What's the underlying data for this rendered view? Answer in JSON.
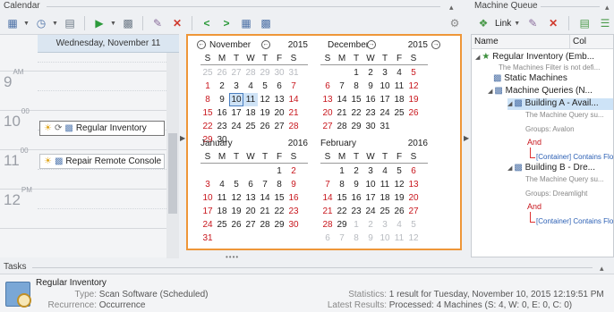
{
  "calendar": {
    "title": "Calendar",
    "day_header": "Wednesday, November 11",
    "hours": [
      {
        "hour": "9",
        "suffix": "AM"
      },
      {
        "hour": "10",
        "suffix": "00"
      },
      {
        "hour": "11",
        "suffix": "00"
      },
      {
        "hour": "12",
        "suffix": "PM"
      }
    ],
    "appointments": [
      {
        "label": "Regular Inventory"
      },
      {
        "label": "Repair Remote Console"
      }
    ]
  },
  "months": [
    {
      "name": "November",
      "year": "2015",
      "dow": [
        "S",
        "M",
        "T",
        "W",
        "T",
        "F",
        "S"
      ],
      "days": [
        [
          "25",
          "o"
        ],
        [
          "26",
          "o"
        ],
        [
          "27",
          "o"
        ],
        [
          "28",
          "o"
        ],
        [
          "29",
          "o"
        ],
        [
          "30",
          "o"
        ],
        [
          "31",
          "o"
        ],
        [
          "1",
          "e"
        ],
        [
          "2",
          "w"
        ],
        [
          "3",
          "w"
        ],
        [
          "4",
          "w"
        ],
        [
          "5",
          "w"
        ],
        [
          "6",
          "w"
        ],
        [
          "7",
          "e"
        ],
        [
          "8",
          "e"
        ],
        [
          "9",
          "w"
        ],
        [
          "10",
          "t"
        ],
        [
          "11",
          "s"
        ],
        [
          "12",
          "w"
        ],
        [
          "13",
          "w"
        ],
        [
          "14",
          "e"
        ],
        [
          "15",
          "e"
        ],
        [
          "16",
          "w"
        ],
        [
          "17",
          "w"
        ],
        [
          "18",
          "w"
        ],
        [
          "19",
          "w"
        ],
        [
          "20",
          "w"
        ],
        [
          "21",
          "e"
        ],
        [
          "22",
          "e"
        ],
        [
          "23",
          "w"
        ],
        [
          "24",
          "w"
        ],
        [
          "25",
          "w"
        ],
        [
          "26",
          "w"
        ],
        [
          "27",
          "w"
        ],
        [
          "28",
          "e"
        ],
        [
          "29",
          "e"
        ],
        [
          "30",
          "w"
        ]
      ]
    },
    {
      "name": "December",
      "year": "2015",
      "dow": [
        "S",
        "M",
        "T",
        "W",
        "T",
        "F",
        "S"
      ],
      "days": [
        [
          "",
          "x"
        ],
        [
          "",
          "x"
        ],
        [
          "1",
          "w"
        ],
        [
          "2",
          "w"
        ],
        [
          "3",
          "w"
        ],
        [
          "4",
          "w"
        ],
        [
          "5",
          "e"
        ],
        [
          "6",
          "e"
        ],
        [
          "7",
          "w"
        ],
        [
          "8",
          "w"
        ],
        [
          "9",
          "w"
        ],
        [
          "10",
          "w"
        ],
        [
          "11",
          "w"
        ],
        [
          "12",
          "e"
        ],
        [
          "13",
          "e"
        ],
        [
          "14",
          "w"
        ],
        [
          "15",
          "w"
        ],
        [
          "16",
          "w"
        ],
        [
          "17",
          "w"
        ],
        [
          "18",
          "w"
        ],
        [
          "19",
          "e"
        ],
        [
          "20",
          "e"
        ],
        [
          "21",
          "w"
        ],
        [
          "22",
          "w"
        ],
        [
          "23",
          "w"
        ],
        [
          "24",
          "w"
        ],
        [
          "25",
          "w"
        ],
        [
          "26",
          "e"
        ],
        [
          "27",
          "e"
        ],
        [
          "28",
          "w"
        ],
        [
          "29",
          "w"
        ],
        [
          "30",
          "w"
        ],
        [
          "31",
          "w"
        ]
      ]
    },
    {
      "name": "January",
      "year": "2016",
      "dow": [
        "S",
        "M",
        "T",
        "W",
        "T",
        "F",
        "S"
      ],
      "days": [
        [
          "",
          "x"
        ],
        [
          "",
          "x"
        ],
        [
          "",
          "x"
        ],
        [
          "",
          "x"
        ],
        [
          "",
          "x"
        ],
        [
          "1",
          "w"
        ],
        [
          "2",
          "e"
        ],
        [
          "3",
          "e"
        ],
        [
          "4",
          "w"
        ],
        [
          "5",
          "w"
        ],
        [
          "6",
          "w"
        ],
        [
          "7",
          "w"
        ],
        [
          "8",
          "w"
        ],
        [
          "9",
          "e"
        ],
        [
          "10",
          "e"
        ],
        [
          "11",
          "w"
        ],
        [
          "12",
          "w"
        ],
        [
          "13",
          "w"
        ],
        [
          "14",
          "w"
        ],
        [
          "15",
          "w"
        ],
        [
          "16",
          "e"
        ],
        [
          "17",
          "e"
        ],
        [
          "18",
          "w"
        ],
        [
          "19",
          "w"
        ],
        [
          "20",
          "w"
        ],
        [
          "21",
          "w"
        ],
        [
          "22",
          "w"
        ],
        [
          "23",
          "e"
        ],
        [
          "24",
          "e"
        ],
        [
          "25",
          "w"
        ],
        [
          "26",
          "w"
        ],
        [
          "27",
          "w"
        ],
        [
          "28",
          "w"
        ],
        [
          "29",
          "w"
        ],
        [
          "30",
          "e"
        ],
        [
          "31",
          "e"
        ]
      ]
    },
    {
      "name": "February",
      "year": "2016",
      "dow": [
        "S",
        "M",
        "T",
        "W",
        "T",
        "F",
        "S"
      ],
      "days": [
        [
          "",
          "x"
        ],
        [
          "1",
          "w"
        ],
        [
          "2",
          "w"
        ],
        [
          "3",
          "w"
        ],
        [
          "4",
          "w"
        ],
        [
          "5",
          "w"
        ],
        [
          "6",
          "e"
        ],
        [
          "7",
          "e"
        ],
        [
          "8",
          "w"
        ],
        [
          "9",
          "w"
        ],
        [
          "10",
          "w"
        ],
        [
          "11",
          "w"
        ],
        [
          "12",
          "w"
        ],
        [
          "13",
          "e"
        ],
        [
          "14",
          "e"
        ],
        [
          "15",
          "w"
        ],
        [
          "16",
          "w"
        ],
        [
          "17",
          "w"
        ],
        [
          "18",
          "w"
        ],
        [
          "19",
          "w"
        ],
        [
          "20",
          "e"
        ],
        [
          "21",
          "e"
        ],
        [
          "22",
          "w"
        ],
        [
          "23",
          "w"
        ],
        [
          "24",
          "w"
        ],
        [
          "25",
          "w"
        ],
        [
          "26",
          "w"
        ],
        [
          "27",
          "e"
        ],
        [
          "28",
          "e"
        ],
        [
          "29",
          "w"
        ],
        [
          "1",
          "o"
        ],
        [
          "2",
          "o"
        ],
        [
          "3",
          "o"
        ],
        [
          "4",
          "o"
        ],
        [
          "5",
          "o"
        ],
        [
          "6",
          "o"
        ],
        [
          "7",
          "o"
        ],
        [
          "8",
          "o"
        ],
        [
          "9",
          "o"
        ],
        [
          "10",
          "o"
        ],
        [
          "11",
          "o"
        ],
        [
          "12",
          "o"
        ]
      ]
    }
  ],
  "machine_queue": {
    "title": "Machine Queue",
    "link_label": "Link",
    "col_name": "Name",
    "col_other": "Col",
    "tree": {
      "root": "Regular Inventory (Emb...",
      "root_sub": "The Machines Filter is not defi...",
      "static": "Static Machines",
      "queries": "Machine Queries (N...",
      "a_label": "Building A - Avail...",
      "a_sub": "The Machine Query su...",
      "a_group": "Groups: Avalon",
      "and": "And",
      "a_cond": "[Container] Contains Flo",
      "b_label": "Building B - Dre...",
      "b_sub": "The Machine Query su...",
      "b_group": "Groups: Dreamlight",
      "b_cond": "[Container] Contains Flo"
    }
  },
  "tasks": {
    "title": "Tasks",
    "task_name": "Regular Inventory",
    "type_label": "Type:",
    "type_value": "Scan Software (Scheduled)",
    "recurrence_label": "Recurrence:",
    "recurrence_value": "Occurrence",
    "statistics_label": "Statistics:",
    "statistics_value": "1 result for Tuesday, November 10, 2015 12:19:51 PM",
    "latest_label": "Latest Results:",
    "latest_value": "Processed: 4 Machines (S: 4, W: 0, E: 0, C: 0)"
  }
}
